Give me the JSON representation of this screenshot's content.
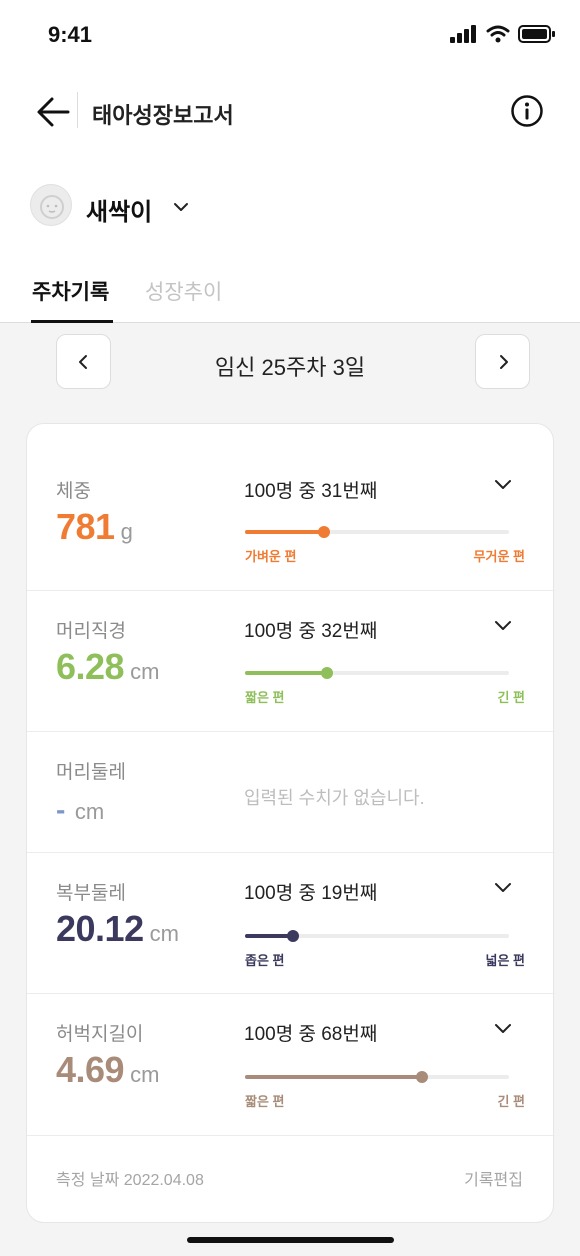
{
  "status": {
    "time": "9:41"
  },
  "nav": {
    "title": "태아성장보고서"
  },
  "profile": {
    "name": "새싹이"
  },
  "tabs": [
    {
      "label": "주차기록",
      "active": true
    },
    {
      "label": "성장추이",
      "active": false
    }
  ],
  "week": {
    "label": "임신 25주차 3일"
  },
  "metrics": [
    {
      "label": "체중",
      "value": "781",
      "unit": "g",
      "color": "#f07b32",
      "rank": "100명 중 31번째",
      "percentile": 0.3,
      "left_label": "가벼운 편",
      "right_label": "무거운 편"
    },
    {
      "label": "머리직경",
      "value": "6.28",
      "unit": "cm",
      "color": "#8fbf5a",
      "rank": "100명 중 32번째",
      "percentile": 0.31,
      "left_label": "짧은 편",
      "right_label": "긴 편"
    },
    {
      "label": "머리둘레",
      "value": "-",
      "unit": "cm",
      "color": "#7f97c8",
      "empty_message": "입력된 수치가 없습니다."
    },
    {
      "label": "복부둘레",
      "value": "20.12",
      "unit": "cm",
      "color": "#3b3a5e",
      "rank": "100명 중 19번째",
      "percentile": 0.18,
      "left_label": "좁은 편",
      "right_label": "넓은 편"
    },
    {
      "label": "허벅지길이",
      "value": "4.69",
      "unit": "cm",
      "color": "#a88c79",
      "rank": "100명 중 68번째",
      "percentile": 0.67,
      "left_label": "짧은 편",
      "right_label": "긴 편"
    }
  ],
  "footer": {
    "date_label": "측정 날짜 2022.04.08",
    "edit_label": "기록편집"
  }
}
